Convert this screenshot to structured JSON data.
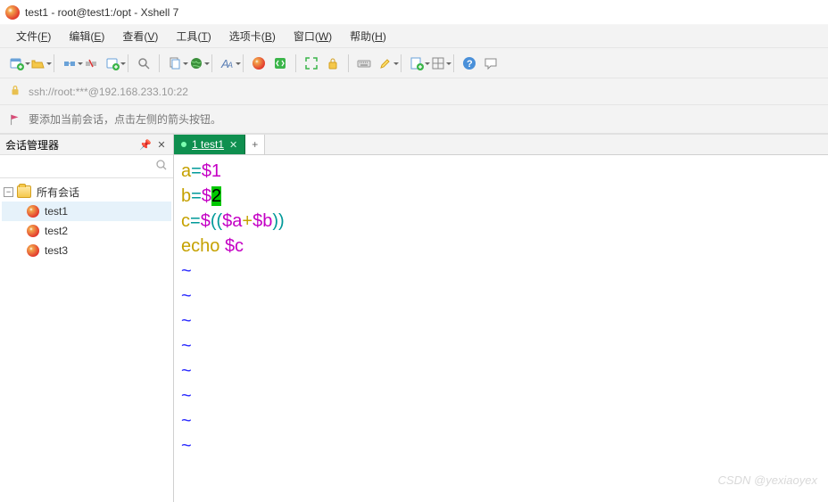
{
  "window": {
    "title": "test1 - root@test1:/opt - Xshell 7"
  },
  "menu": {
    "file": {
      "label": "文件",
      "accel": "F"
    },
    "edit": {
      "label": "编辑",
      "accel": "E"
    },
    "view": {
      "label": "查看",
      "accel": "V"
    },
    "tools": {
      "label": "工具",
      "accel": "T"
    },
    "tabs": {
      "label": "选项卡",
      "accel": "B"
    },
    "window": {
      "label": "窗口",
      "accel": "W"
    },
    "help": {
      "label": "帮助",
      "accel": "H"
    }
  },
  "address": {
    "url": "ssh://root:***@192.168.233.10:22"
  },
  "hint": {
    "text": "要添加当前会话，点击左侧的箭头按钮。"
  },
  "sidebar": {
    "title": "会话管理器",
    "search_placeholder": "",
    "root": "所有会话",
    "items": [
      {
        "name": "test1",
        "selected": true
      },
      {
        "name": "test2",
        "selected": false
      },
      {
        "name": "test3",
        "selected": false
      }
    ]
  },
  "tabs": {
    "items": [
      {
        "index": "1",
        "label": "test1"
      }
    ],
    "add": "+"
  },
  "terminal": {
    "lines": [
      {
        "segments": [
          {
            "t": "a",
            "c": "yellow"
          },
          {
            "t": "=",
            "c": "teal"
          },
          {
            "t": "$1",
            "c": "mag"
          }
        ]
      },
      {
        "segments": [
          {
            "t": "b",
            "c": "yellow"
          },
          {
            "t": "=",
            "c": "teal"
          },
          {
            "t": "$",
            "c": "mag"
          },
          {
            "t": "2",
            "c": "cursor"
          }
        ]
      },
      {
        "segments": [
          {
            "t": "c",
            "c": "yellow"
          },
          {
            "t": "=",
            "c": "teal"
          },
          {
            "t": "$",
            "c": "mag"
          },
          {
            "t": "((",
            "c": "teal"
          },
          {
            "t": "$a",
            "c": "mag"
          },
          {
            "t": "+",
            "c": "yellow"
          },
          {
            "t": "$b",
            "c": "mag"
          },
          {
            "t": "))",
            "c": "teal"
          }
        ]
      },
      {
        "segments": [
          {
            "t": "echo ",
            "c": "yellow"
          },
          {
            "t": "$c",
            "c": "mag"
          }
        ]
      },
      {
        "segments": [
          {
            "t": "~",
            "c": "blue"
          }
        ]
      },
      {
        "segments": [
          {
            "t": "~",
            "c": "blue"
          }
        ]
      },
      {
        "segments": [
          {
            "t": "~",
            "c": "blue"
          }
        ]
      },
      {
        "segments": [
          {
            "t": "~",
            "c": "blue"
          }
        ]
      },
      {
        "segments": [
          {
            "t": "~",
            "c": "blue"
          }
        ]
      },
      {
        "segments": [
          {
            "t": "~",
            "c": "blue"
          }
        ]
      },
      {
        "segments": [
          {
            "t": "~",
            "c": "blue"
          }
        ]
      },
      {
        "segments": [
          {
            "t": "~",
            "c": "blue"
          }
        ]
      }
    ]
  },
  "watermark": "CSDN @yexiaoyex"
}
